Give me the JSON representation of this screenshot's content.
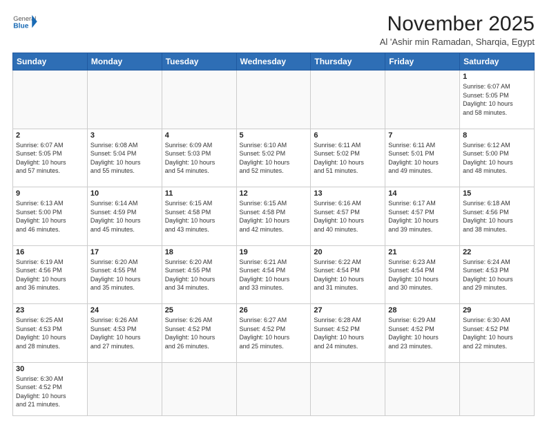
{
  "header": {
    "logo_general": "General",
    "logo_blue": "Blue",
    "month_title": "November 2025",
    "subtitle": "Al 'Ashir min Ramadan, Sharqia, Egypt"
  },
  "weekdays": [
    "Sunday",
    "Monday",
    "Tuesday",
    "Wednesday",
    "Thursday",
    "Friday",
    "Saturday"
  ],
  "weeks": [
    [
      {
        "num": "",
        "info": ""
      },
      {
        "num": "",
        "info": ""
      },
      {
        "num": "",
        "info": ""
      },
      {
        "num": "",
        "info": ""
      },
      {
        "num": "",
        "info": ""
      },
      {
        "num": "",
        "info": ""
      },
      {
        "num": "1",
        "info": "Sunrise: 6:07 AM\nSunset: 5:05 PM\nDaylight: 10 hours\nand 58 minutes."
      }
    ],
    [
      {
        "num": "2",
        "info": "Sunrise: 6:07 AM\nSunset: 5:05 PM\nDaylight: 10 hours\nand 57 minutes."
      },
      {
        "num": "3",
        "info": "Sunrise: 6:08 AM\nSunset: 5:04 PM\nDaylight: 10 hours\nand 55 minutes."
      },
      {
        "num": "4",
        "info": "Sunrise: 6:09 AM\nSunset: 5:03 PM\nDaylight: 10 hours\nand 54 minutes."
      },
      {
        "num": "5",
        "info": "Sunrise: 6:10 AM\nSunset: 5:02 PM\nDaylight: 10 hours\nand 52 minutes."
      },
      {
        "num": "6",
        "info": "Sunrise: 6:11 AM\nSunset: 5:02 PM\nDaylight: 10 hours\nand 51 minutes."
      },
      {
        "num": "7",
        "info": "Sunrise: 6:11 AM\nSunset: 5:01 PM\nDaylight: 10 hours\nand 49 minutes."
      },
      {
        "num": "8",
        "info": "Sunrise: 6:12 AM\nSunset: 5:00 PM\nDaylight: 10 hours\nand 48 minutes."
      }
    ],
    [
      {
        "num": "9",
        "info": "Sunrise: 6:13 AM\nSunset: 5:00 PM\nDaylight: 10 hours\nand 46 minutes."
      },
      {
        "num": "10",
        "info": "Sunrise: 6:14 AM\nSunset: 4:59 PM\nDaylight: 10 hours\nand 45 minutes."
      },
      {
        "num": "11",
        "info": "Sunrise: 6:15 AM\nSunset: 4:58 PM\nDaylight: 10 hours\nand 43 minutes."
      },
      {
        "num": "12",
        "info": "Sunrise: 6:15 AM\nSunset: 4:58 PM\nDaylight: 10 hours\nand 42 minutes."
      },
      {
        "num": "13",
        "info": "Sunrise: 6:16 AM\nSunset: 4:57 PM\nDaylight: 10 hours\nand 40 minutes."
      },
      {
        "num": "14",
        "info": "Sunrise: 6:17 AM\nSunset: 4:57 PM\nDaylight: 10 hours\nand 39 minutes."
      },
      {
        "num": "15",
        "info": "Sunrise: 6:18 AM\nSunset: 4:56 PM\nDaylight: 10 hours\nand 38 minutes."
      }
    ],
    [
      {
        "num": "16",
        "info": "Sunrise: 6:19 AM\nSunset: 4:56 PM\nDaylight: 10 hours\nand 36 minutes."
      },
      {
        "num": "17",
        "info": "Sunrise: 6:20 AM\nSunset: 4:55 PM\nDaylight: 10 hours\nand 35 minutes."
      },
      {
        "num": "18",
        "info": "Sunrise: 6:20 AM\nSunset: 4:55 PM\nDaylight: 10 hours\nand 34 minutes."
      },
      {
        "num": "19",
        "info": "Sunrise: 6:21 AM\nSunset: 4:54 PM\nDaylight: 10 hours\nand 33 minutes."
      },
      {
        "num": "20",
        "info": "Sunrise: 6:22 AM\nSunset: 4:54 PM\nDaylight: 10 hours\nand 31 minutes."
      },
      {
        "num": "21",
        "info": "Sunrise: 6:23 AM\nSunset: 4:54 PM\nDaylight: 10 hours\nand 30 minutes."
      },
      {
        "num": "22",
        "info": "Sunrise: 6:24 AM\nSunset: 4:53 PM\nDaylight: 10 hours\nand 29 minutes."
      }
    ],
    [
      {
        "num": "23",
        "info": "Sunrise: 6:25 AM\nSunset: 4:53 PM\nDaylight: 10 hours\nand 28 minutes."
      },
      {
        "num": "24",
        "info": "Sunrise: 6:26 AM\nSunset: 4:53 PM\nDaylight: 10 hours\nand 27 minutes."
      },
      {
        "num": "25",
        "info": "Sunrise: 6:26 AM\nSunset: 4:52 PM\nDaylight: 10 hours\nand 26 minutes."
      },
      {
        "num": "26",
        "info": "Sunrise: 6:27 AM\nSunset: 4:52 PM\nDaylight: 10 hours\nand 25 minutes."
      },
      {
        "num": "27",
        "info": "Sunrise: 6:28 AM\nSunset: 4:52 PM\nDaylight: 10 hours\nand 24 minutes."
      },
      {
        "num": "28",
        "info": "Sunrise: 6:29 AM\nSunset: 4:52 PM\nDaylight: 10 hours\nand 23 minutes."
      },
      {
        "num": "29",
        "info": "Sunrise: 6:30 AM\nSunset: 4:52 PM\nDaylight: 10 hours\nand 22 minutes."
      }
    ],
    [
      {
        "num": "30",
        "info": "Sunrise: 6:30 AM\nSunset: 4:52 PM\nDaylight: 10 hours\nand 21 minutes."
      },
      {
        "num": "",
        "info": ""
      },
      {
        "num": "",
        "info": ""
      },
      {
        "num": "",
        "info": ""
      },
      {
        "num": "",
        "info": ""
      },
      {
        "num": "",
        "info": ""
      },
      {
        "num": "",
        "info": ""
      }
    ]
  ]
}
